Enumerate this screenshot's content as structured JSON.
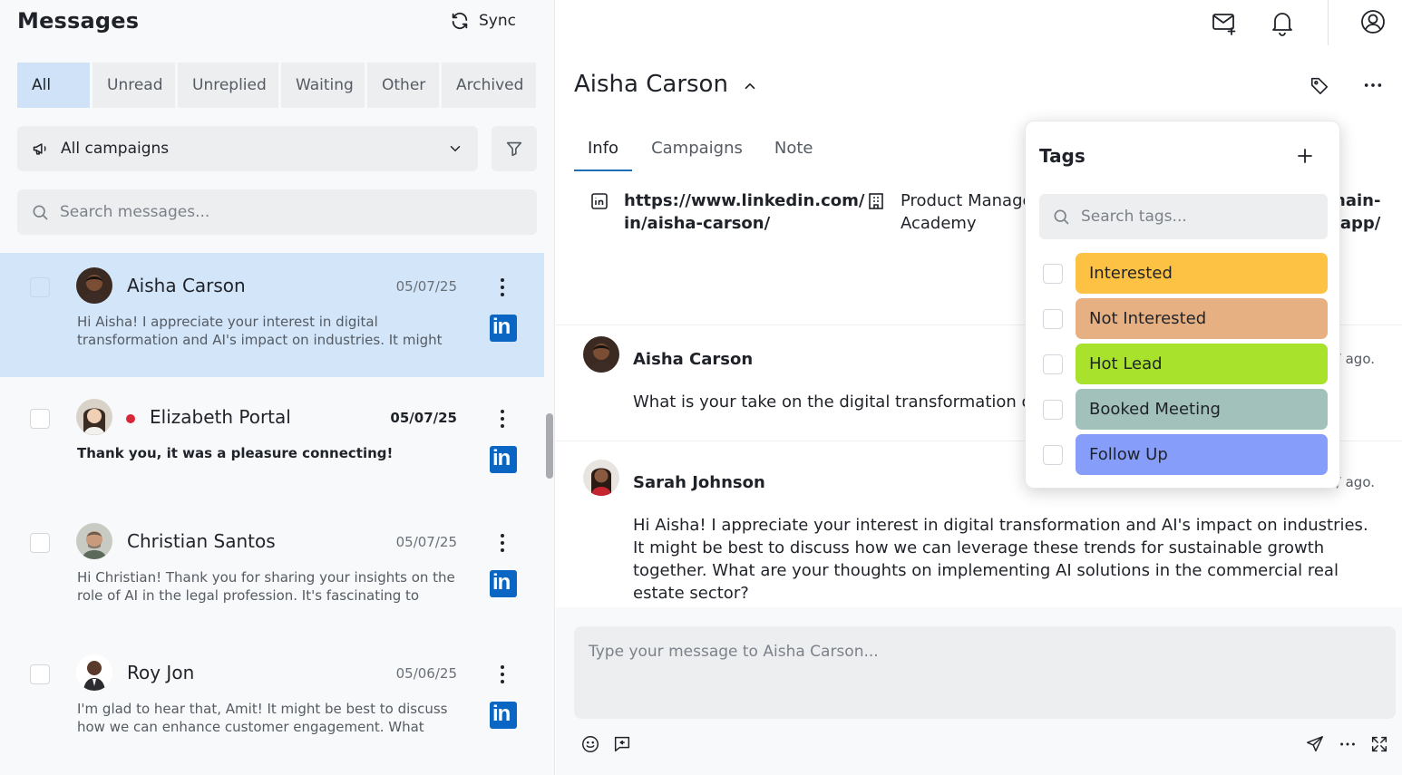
{
  "left": {
    "title": "Messages",
    "sync_label": "Sync",
    "filter_tabs": [
      "All",
      "Unread",
      "Unreplied",
      "Waiting",
      "Other",
      "Archived"
    ],
    "active_tab": "All",
    "campaign_select": "All campaigns",
    "search_placeholder": "Search messages...",
    "conversations": [
      {
        "name": "Aisha Carson",
        "date": "05/07/25",
        "preview": "Hi Aisha! I appreciate your interest in digital transformation and AI's impact on industries. It might be...",
        "selected": true,
        "unread": false,
        "channel_icon": "linkedin-icon"
      },
      {
        "name": "Elizabeth Portal",
        "date": "05/07/25",
        "preview": "Thank you, it was a pleasure connecting!",
        "selected": false,
        "unread": true,
        "channel_icon": "linkedin-icon"
      },
      {
        "name": "Christian Santos",
        "date": "05/07/25",
        "preview": "Hi Christian! Thank you for sharing your insights on the role of AI in the legal profession. It's fascinating to hear...",
        "selected": false,
        "unread": false,
        "channel_icon": "linkedin-icon"
      },
      {
        "name": "Roy Jon",
        "date": "05/06/25",
        "preview": "I'm glad to hear that, Amit! It might be best to discuss how we can enhance customer engagement. What specific...",
        "selected": false,
        "unread": false,
        "channel_icon": "linkedin-icon"
      }
    ]
  },
  "right": {
    "contact_name": "Aisha Carson",
    "tabs": [
      "Info",
      "Campaigns",
      "Note"
    ],
    "active_tab": "Info",
    "info": {
      "linkedin_line1": "https://www.linkedin.com/",
      "linkedin_line2": "in/aisha-carson/",
      "company_line1": "Product Manage",
      "company_line2": "Academy",
      "domain_line1": "nain-",
      "domain_line2": ".app/"
    },
    "messages": [
      {
        "sender": "Aisha Carson",
        "time": "/ ago.",
        "body": "What is your take on the digital transformation ongo"
      },
      {
        "sender": "Sarah Johnson",
        "time": "/ ago.",
        "body": "Hi Aisha! I appreciate your interest in digital transformation and AI's impact on industries. It might be best to discuss how we can leverage these trends for sustainable growth together. What are your thoughts on implementing AI solutions in the commercial real estate sector?"
      }
    ],
    "compose_placeholder": "Type your message to Aisha Carson..."
  },
  "tags_popover": {
    "title": "Tags",
    "search_placeholder": "Search tags...",
    "tags": [
      {
        "label": "Interested",
        "color": "#fdc243"
      },
      {
        "label": "Not Interested",
        "color": "#e6b083"
      },
      {
        "label": "Hot Lead",
        "color": "#a8e22d"
      },
      {
        "label": "Booked Meeting",
        "color": "#a2c1bb"
      },
      {
        "label": "Follow Up",
        "color": "#879dfa"
      }
    ]
  },
  "colors": {
    "accent": "#1f6fb8",
    "selected_row": "#d3e5f9",
    "linkedin": "#0a66c2",
    "unread_dot": "#d62839"
  }
}
